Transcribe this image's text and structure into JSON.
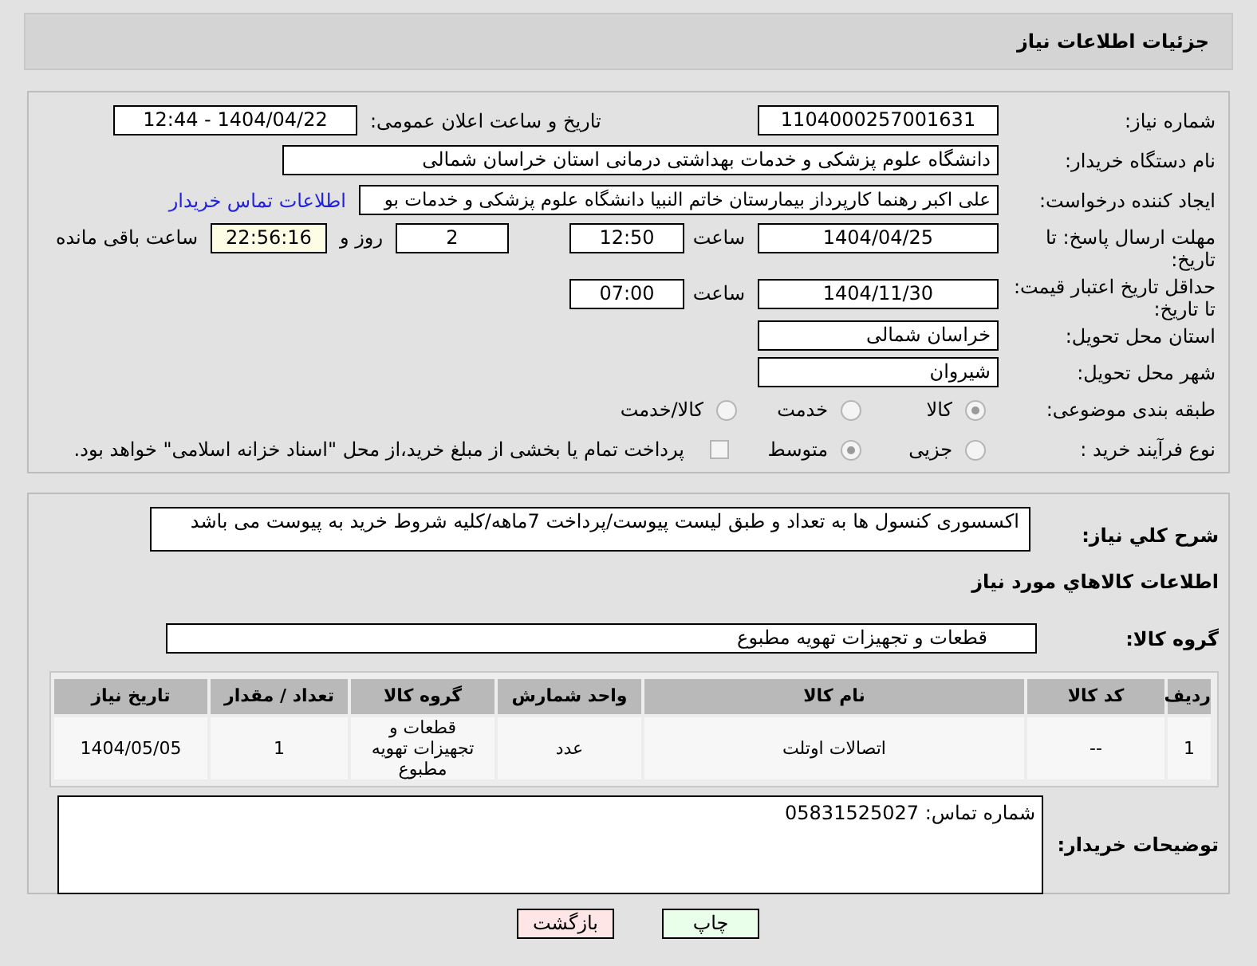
{
  "header": {
    "title": "جزئیات اطلاعات نیاز"
  },
  "need_number": {
    "label": "شماره نیاز:",
    "value": "1104000257001631"
  },
  "announce": {
    "label": "تاریخ و ساعت اعلان عمومی:",
    "value": "1404/04/22 - 12:44"
  },
  "buyer_org": {
    "label": "نام دستگاه خریدار:",
    "value": "دانشگاه علوم پزشکی و خدمات بهداشتی درمانی استان خراسان شمالی"
  },
  "requester": {
    "label": "ایجاد کننده درخواست:",
    "value": "علی اکبر رهنما کارپرداز بیمارستان خاتم النبیا دانشگاه علوم پزشکی و خدمات بو",
    "link": "اطلاعات تماس خریدار"
  },
  "deadline": {
    "label": "مهلت ارسال پاسخ: تا تاریخ:",
    "date": "1404/04/25",
    "time_label": "ساعت",
    "time": "12:50",
    "days": "2",
    "days_label": "روز و",
    "remaining": "22:56:16",
    "remaining_label": "ساعت باقی مانده"
  },
  "validity": {
    "label": "حداقل تاریخ اعتبار قیمت: تا تاریخ:",
    "date": "1404/11/30",
    "time_label": "ساعت",
    "time": "07:00"
  },
  "province": {
    "label": "استان محل تحویل:",
    "value": "خراسان شمالی"
  },
  "city": {
    "label": "شهر محل تحویل:",
    "value": "شیروان"
  },
  "category": {
    "label": "طبقه بندی موضوعی:",
    "options": [
      {
        "label": "کالا",
        "selected": true
      },
      {
        "label": "خدمت",
        "selected": false
      },
      {
        "label": "کالا/خدمت",
        "selected": false
      }
    ]
  },
  "process": {
    "label": "نوع فرآیند خرید :",
    "options": [
      {
        "label": "جزیی",
        "selected": false
      },
      {
        "label": "متوسط",
        "selected": true
      }
    ],
    "treasury": {
      "checked": false,
      "label": "پرداخت تمام یا بخشی از مبلغ خرید،از محل \"اسناد خزانه اسلامی\" خواهد بود."
    }
  },
  "summary": {
    "label": "شرح کلي نياز:",
    "value": "اکسسوری کنسول ها به تعداد و طبق لیست پیوست/پرداخت 7ماهه/کلیه شروط خرید به پیوست می باشد"
  },
  "goods_heading": "اطلاعات کالاهاي مورد نياز",
  "goods_group": {
    "label": "گروه کالا:",
    "value": "قطعات و تجهیزات تهویه مطبوع"
  },
  "table": {
    "columns": [
      "ردیف",
      "کد کالا",
      "نام کالا",
      "واحد شمارش",
      "گروه کالا",
      "تعداد / مقدار",
      "تاریخ نیاز"
    ],
    "rows": [
      [
        "1",
        "--",
        "اتصالات اوتلت",
        "عدد",
        "قطعات و تجهیزات تهویه مطبوع",
        "1",
        "1404/05/05"
      ]
    ]
  },
  "buyer_notes": {
    "label": "توضیحات خریدار:",
    "value": "شماره تماس: 05831525027"
  },
  "buttons": [
    {
      "kind": "print",
      "label": "چاپ"
    },
    {
      "kind": "back",
      "label": "بازگشت"
    }
  ]
}
